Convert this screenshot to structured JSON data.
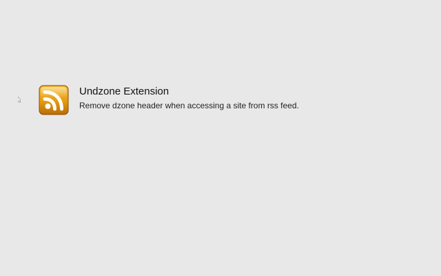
{
  "extension": {
    "icon": "rss-icon",
    "name": "Undzone Extension",
    "description": "Remove dzone header when accessing a site from rss feed."
  },
  "colors": {
    "background": "#e8e8e9",
    "icon_orange": "#e59a12",
    "icon_dark_orange": "#b76c06"
  }
}
